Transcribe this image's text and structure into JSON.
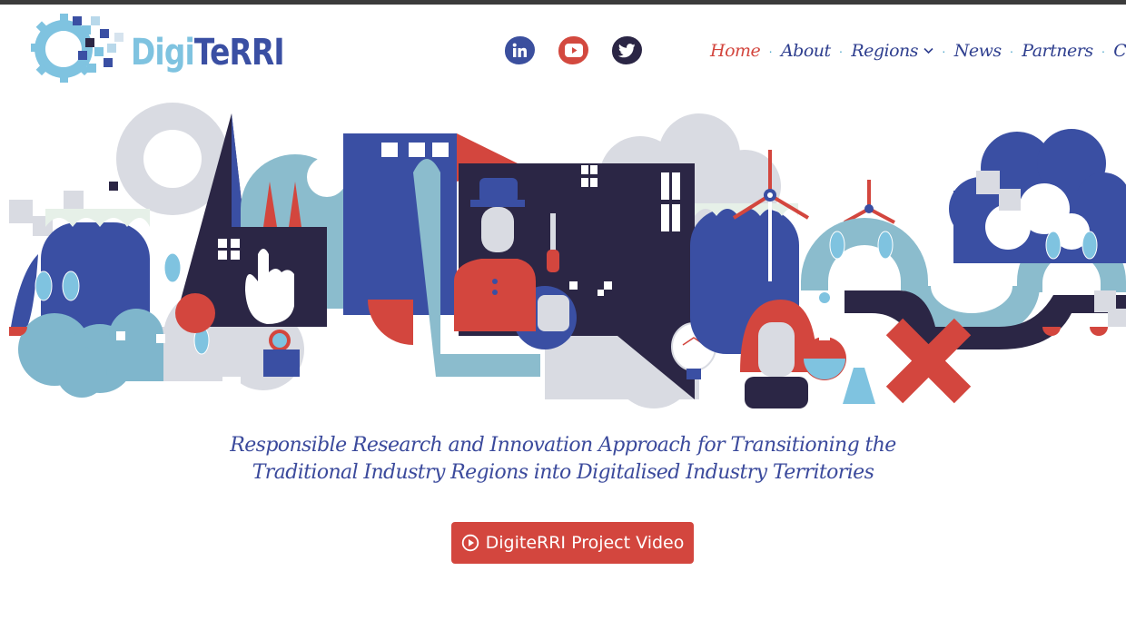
{
  "brand": {
    "logo_part1": "Digi",
    "logo_part2": "TeRRI"
  },
  "social": [
    {
      "name": "linkedin",
      "icon": "linkedin-icon",
      "color": "#3b4f9e"
    },
    {
      "name": "youtube",
      "icon": "youtube-icon",
      "color": "#d3493f"
    },
    {
      "name": "twitter",
      "icon": "twitter-icon",
      "color": "#2b2645"
    }
  ],
  "nav": {
    "items": [
      {
        "label": "Home",
        "active": true
      },
      {
        "label": "About"
      },
      {
        "label": "Regions",
        "has_dropdown": true
      },
      {
        "label": "News"
      },
      {
        "label": "Partners"
      },
      {
        "label": "Contact"
      }
    ]
  },
  "hero": {
    "tagline_line1": "Responsible Research and Innovation Approach for Transitioning the",
    "tagline_line2": "Traditional Industry Regions into Digitalised Industry Territories"
  },
  "cta": {
    "video_label": "DigiteRRI Project Video",
    "icon": "play-circle-icon"
  },
  "colors": {
    "accent_red": "#d3463e",
    "brand_blue": "#3a4fa3",
    "light_blue": "#7fc3e0",
    "navy": "#2b2645"
  }
}
